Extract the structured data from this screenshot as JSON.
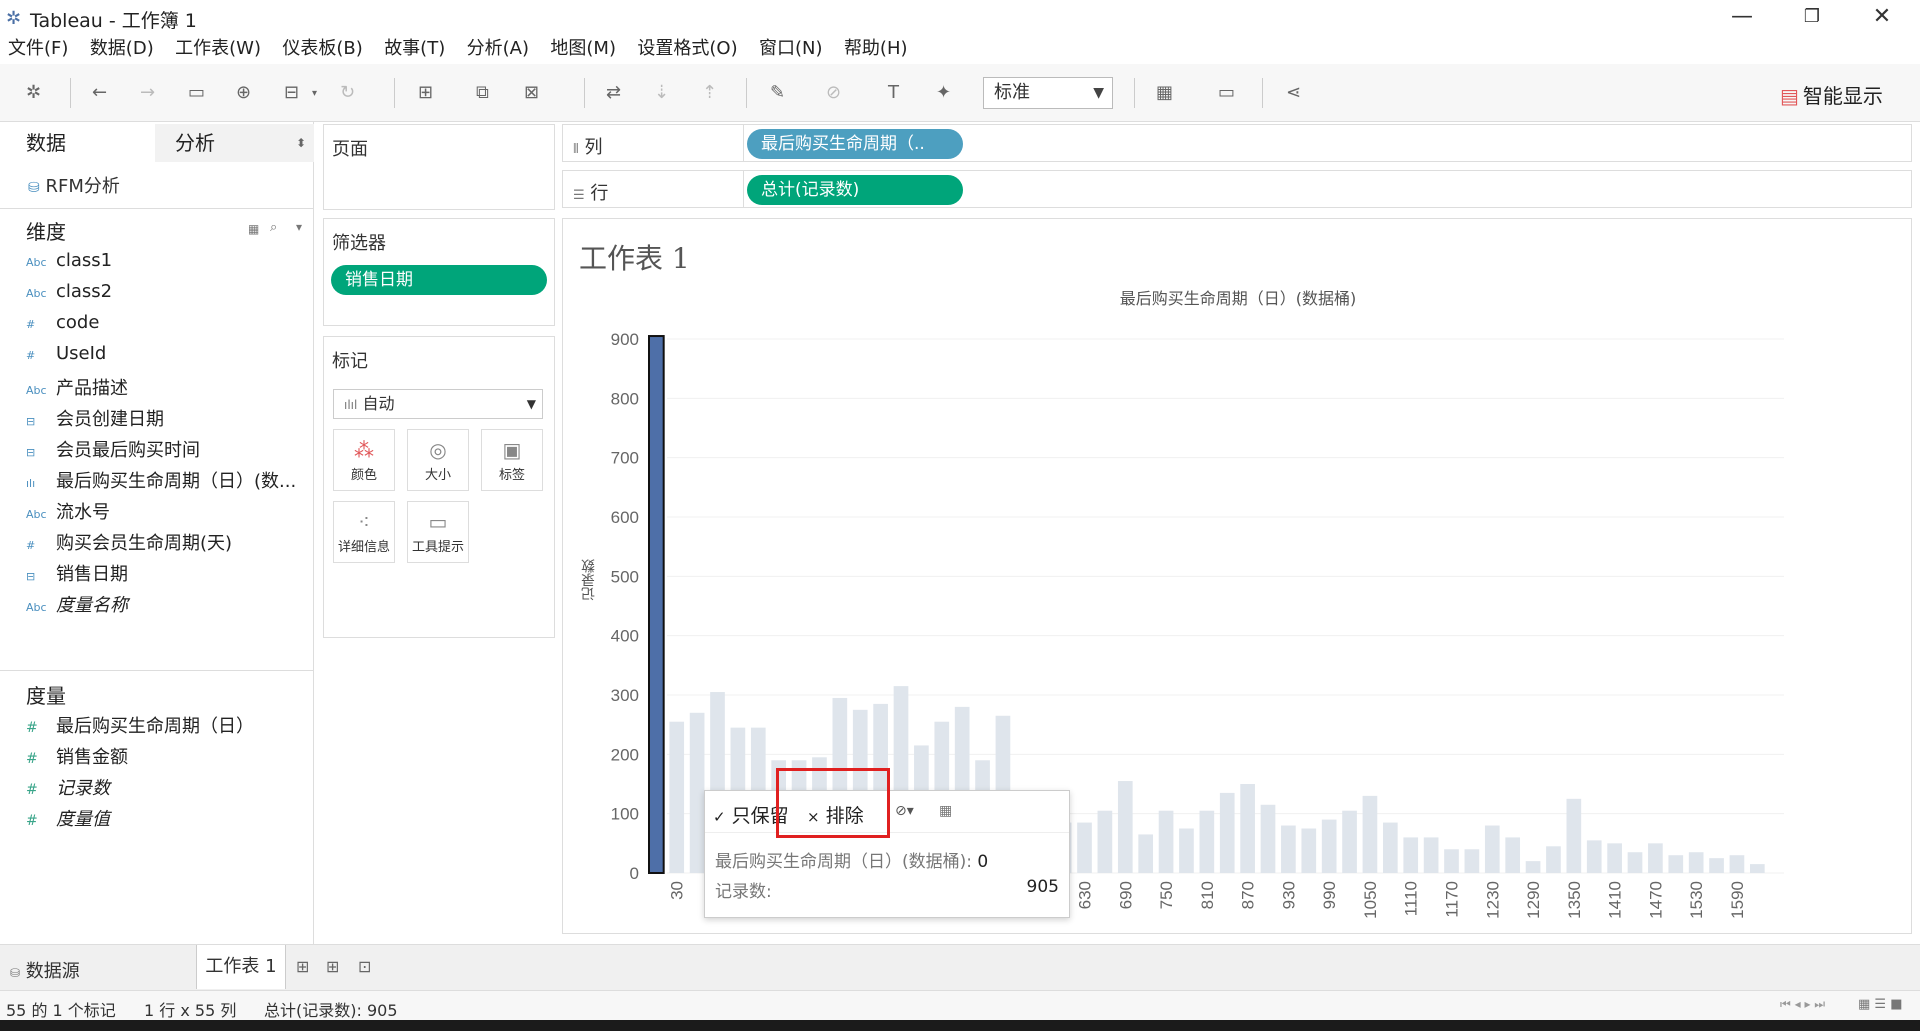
{
  "window": {
    "title": "Tableau - 工作簿 1",
    "minimize": "—",
    "restore": "❐",
    "close": "✕"
  },
  "menu": [
    "文件(F)",
    "数据(D)",
    "工作表(W)",
    "仪表板(B)",
    "故事(T)",
    "分析(A)",
    "地图(M)",
    "设置格式(O)",
    "窗口(N)",
    "帮助(H)"
  ],
  "toolbar": {
    "fit_value": "标准",
    "show_me": "智能显示"
  },
  "left_pane": {
    "tab_data": "数据",
    "tab_analysis": "分析",
    "datasource": "RFM分析",
    "dimensions_header": "维度",
    "dimensions": [
      {
        "label": "class1",
        "icon": "Abc",
        "italic": false
      },
      {
        "label": "class2",
        "icon": "Abc",
        "italic": false
      },
      {
        "label": "code",
        "icon": "#",
        "italic": false
      },
      {
        "label": "UseId",
        "icon": "#",
        "italic": false
      },
      {
        "label": "产品描述",
        "icon": "Abc",
        "italic": false
      },
      {
        "label": "会员创建日期",
        "icon": "date",
        "italic": false
      },
      {
        "label": "会员最后购买时间",
        "icon": "datetime",
        "italic": false
      },
      {
        "label": "最后购买生命周期（日）(数...",
        "icon": "bin",
        "italic": false
      },
      {
        "label": "流水号",
        "icon": "Abc",
        "italic": false
      },
      {
        "label": "购买会员生命周期(天)",
        "icon": "#",
        "italic": false
      },
      {
        "label": "销售日期",
        "icon": "date",
        "italic": false
      },
      {
        "label": "度量名称",
        "icon": "Abc",
        "italic": true
      }
    ],
    "measures_header": "度量",
    "measures": [
      {
        "label": "最后购买生命周期（日）",
        "italic": false
      },
      {
        "label": "销售金额",
        "italic": false
      },
      {
        "label": "记录数",
        "italic": true
      },
      {
        "label": "度量值",
        "italic": true
      }
    ]
  },
  "pages_card": {
    "title": "页面"
  },
  "filters_card": {
    "title": "筛选器",
    "pill": "销售日期"
  },
  "marks_card": {
    "title": "标记",
    "type": "自动",
    "buttons": [
      {
        "name": "color",
        "label": "颜色"
      },
      {
        "name": "size",
        "label": "大小"
      },
      {
        "name": "label",
        "label": "标签"
      },
      {
        "name": "detail",
        "label": "详细信息"
      },
      {
        "name": "tooltip",
        "label": "工具提示"
      }
    ]
  },
  "shelves": {
    "columns_label": "列",
    "columns_pill": "最后购买生命周期（..",
    "rows_label": "行",
    "rows_pill": "总计(记录数)"
  },
  "view": {
    "sheet_title": "工作表 1"
  },
  "chart_data": {
    "type": "bar",
    "title": "最后购买生命周期（日）(数据桶)",
    "ylabel": "记录数",
    "ylim": [
      0,
      900
    ],
    "yticks": [
      0,
      100,
      200,
      300,
      400,
      500,
      600,
      700,
      800,
      900
    ],
    "x_tick_labels": [
      "30",
      "630",
      "690",
      "750",
      "810",
      "870",
      "930",
      "990",
      "1050",
      "1110",
      "1170",
      "1230",
      "1290",
      "1350",
      "1410",
      "1470",
      "1530",
      "1590"
    ],
    "selected_index": 0,
    "categories": [
      0,
      30,
      60,
      90,
      120,
      150,
      180,
      210,
      240,
      270,
      300,
      330,
      360,
      390,
      420,
      450,
      480,
      510,
      540,
      570,
      600,
      630,
      660,
      690,
      720,
      750,
      780,
      810,
      840,
      870,
      900,
      930,
      960,
      990,
      1020,
      1050,
      1080,
      1110,
      1140,
      1170,
      1200,
      1230,
      1260,
      1290,
      1320,
      1350,
      1380,
      1410,
      1440,
      1470,
      1500,
      1530,
      1560,
      1590,
      1620
    ],
    "values": [
      905,
      255,
      270,
      305,
      245,
      245,
      190,
      190,
      195,
      295,
      275,
      285,
      315,
      215,
      255,
      280,
      190,
      265,
      80,
      85,
      85,
      85,
      105,
      155,
      65,
      105,
      75,
      105,
      135,
      150,
      115,
      80,
      75,
      90,
      105,
      130,
      85,
      60,
      60,
      40,
      40,
      80,
      60,
      20,
      45,
      125,
      55,
      50,
      35,
      50,
      30,
      35,
      25,
      30,
      15
    ],
    "bar_color": "#dfe5ec",
    "selected_color": "#4e6fa8"
  },
  "tooltip": {
    "keep_only": "只保留",
    "exclude": "排除",
    "field_label": "最后购买生命周期（日）(数据桶):",
    "field_value": "0",
    "count_label": "记录数:",
    "count_value": "905"
  },
  "bottom_tabs": {
    "datasource": "数据源",
    "sheet": "工作表 1"
  },
  "status": {
    "marks": "55 的 1 个标记",
    "dims": "1 行 x 55 列",
    "sum": "总计(记录数): 905"
  }
}
